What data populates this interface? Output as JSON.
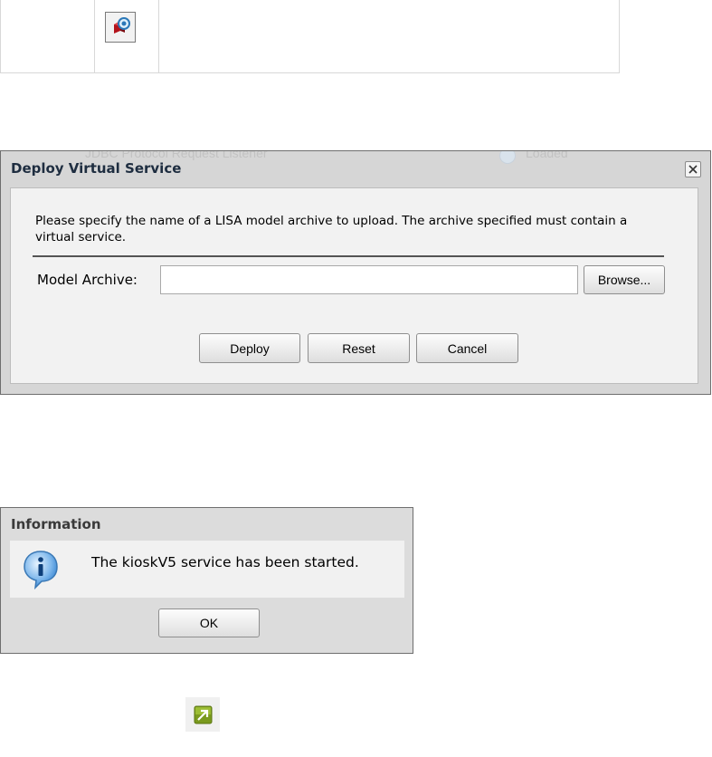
{
  "background_list": {
    "ghost_col1": "JDBC Protocol Request Listener",
    "ghost_col2": "Loaded"
  },
  "deploy_dialog": {
    "title": "Deploy Virtual Service",
    "instructions": "Please specify the name of a LISA model archive to upload.  The archive specified must contain a virtual service.",
    "model_archive_label": "Model Archive:",
    "model_archive_value": "",
    "browse_label": "Browse...",
    "deploy_label": "Deploy",
    "reset_label": "Reset",
    "cancel_label": "Cancel"
  },
  "info_dialog": {
    "title": "Information",
    "message": "The kioskV5 service has been started.",
    "ok_label": "OK"
  },
  "colors": {
    "dialog_frame": "#d6d6d6",
    "dialog_body": "#f2f2f2",
    "title_text": "#1e2d40",
    "info_icon_blue": "#2f7fcf",
    "launch_icon_green": "#7a9a1e"
  },
  "icons": {
    "deploy_vs": "deploy-virtual-service-icon",
    "info": "info-icon",
    "launch": "launch-arrow-icon",
    "close": "close-icon"
  }
}
